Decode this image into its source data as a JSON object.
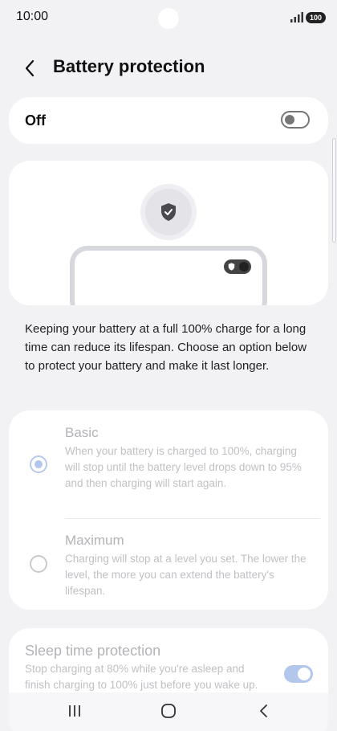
{
  "status_bar": {
    "time": "10:00",
    "battery": "100"
  },
  "header": {
    "title": "Battery protection"
  },
  "master_switch": {
    "label": "Off",
    "state": "off"
  },
  "description": "Keeping your battery at a full 100% charge for a long time can reduce its lifespan. Choose an option below to protect your battery and make it last longer.",
  "options": [
    {
      "title": "Basic",
      "description": "When your battery is charged to 100%, charging will stop until the battery level drops down to 95% and then charging will start again.",
      "selected": true
    },
    {
      "title": "Maximum",
      "description": "Charging will stop at a level you set. The lower the level, the more you can extend the battery's lifespan.",
      "selected": false
    }
  ],
  "sleep_protection": {
    "title": "Sleep time protection",
    "description": "Stop charging at 80% while you're asleep and finish charging to 100% just before you wake up.",
    "state": "on"
  },
  "colors": {
    "accent_disabled": "#b3c6ec",
    "background": "#f2f2f5",
    "card": "#ffffff"
  },
  "nav": {
    "icons": [
      "recent-apps-icon",
      "home-icon",
      "back-icon"
    ]
  }
}
